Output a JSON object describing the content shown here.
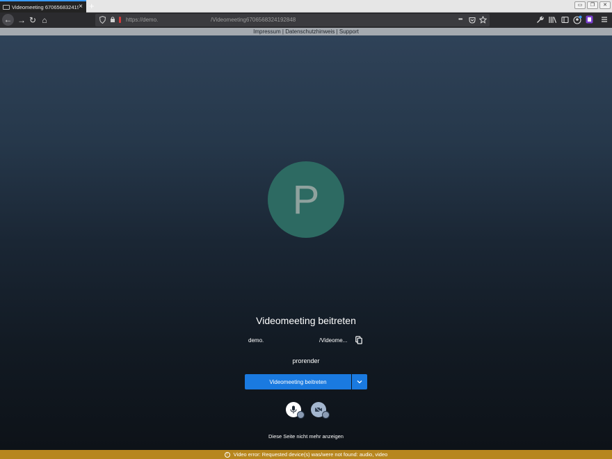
{
  "browser": {
    "tab_title": "Videomeeting 6706568324192848",
    "tab_close": "×",
    "new_tab": "+",
    "window_controls": {
      "minimize": "▭",
      "restore": "❐",
      "close": "✕"
    },
    "nav": {
      "back": "←",
      "forward": "→",
      "reload": "↻",
      "home": "⌂"
    },
    "url_host": "https://demo.",
    "url_path": "/Videomeeting6706568324192848",
    "url_icons": {
      "shield": "shield-icon",
      "lock": "lock-icon"
    },
    "page_actions": "•••",
    "toolbar_icons": [
      "pocket-icon",
      "bookmark-star-icon",
      "wrench-icon",
      "library-icon",
      "sidebar-icon",
      "account-icon",
      "extension-icon",
      "menu-icon"
    ]
  },
  "infobar": {
    "text": "Impressum | Datenschutzhinweis | Support"
  },
  "prejoin": {
    "avatar_letter": "P",
    "title": "Videomeeting beitreten",
    "meeting_url_start": "demo.",
    "meeting_url_end": "/Videome...",
    "display_name": "prorender",
    "join_label": "Videomeeting beitreten",
    "dropdown_glyph": "⌄",
    "hide_label": "Diese Seite nicht mehr anzeigen"
  },
  "error": {
    "icon": "!",
    "text": "Video error: Requested device(s) was/were not found: audio, video"
  },
  "colors": {
    "accent": "#1a7ae0",
    "avatar": "#2d6a62",
    "error_bar": "#b7861e"
  }
}
